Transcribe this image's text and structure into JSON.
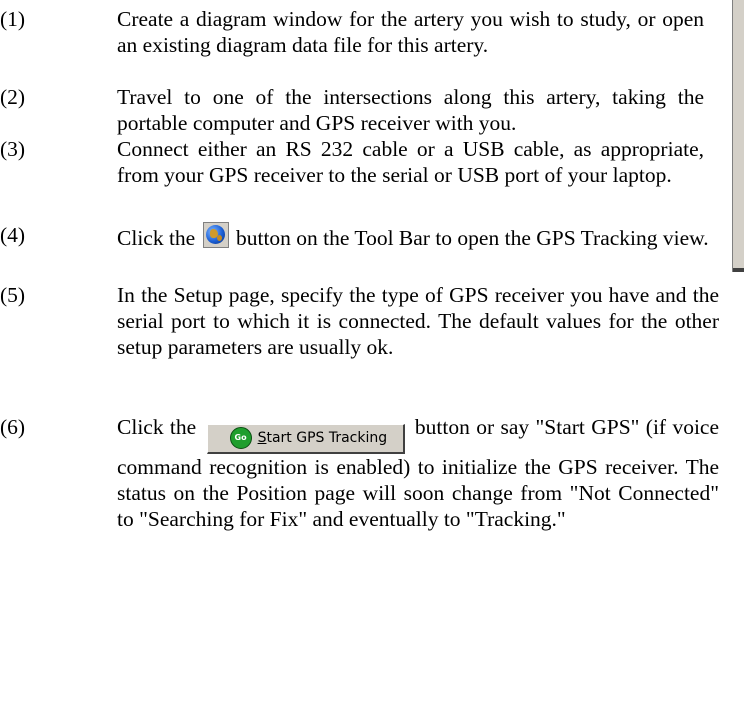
{
  "steps": [
    {
      "number": "(1)",
      "text": "Create a diagram window for the artery you wish to study, or open an existing diagram data file for this artery."
    },
    {
      "number": "(2)",
      "text": "Travel to one of the intersections along this artery, taking the portable computer and GPS receiver with you."
    },
    {
      "number": "(3)",
      "text": "Connect either an RS 232 cable or a USB cable, as appropriate, from your GPS receiver to the serial or USB port of your laptop."
    },
    {
      "number": "(4)",
      "before": "Click the",
      "after": "button on the Tool Bar to open the GPS Tracking view."
    },
    {
      "number": "(5)",
      "text": "In the Setup page, specify the type of GPS receiver you have and the serial port to which it is connected. The default values for the other setup parameters are usually ok."
    },
    {
      "number": "(6)",
      "before": "Click the",
      "after": "button or say \"Start GPS\" (if  voice command recognition is enabled) to initialize the GPS receiver.  The status on the Position page will soon change from \"Not Connected\" to \"Searching for Fix\" and eventually to \"Tracking.\""
    }
  ],
  "toolbar_button": {
    "icon": "globe-icon",
    "go_label": "Go",
    "label_underlined": "S",
    "label_rest": "tart GPS Tracking"
  }
}
